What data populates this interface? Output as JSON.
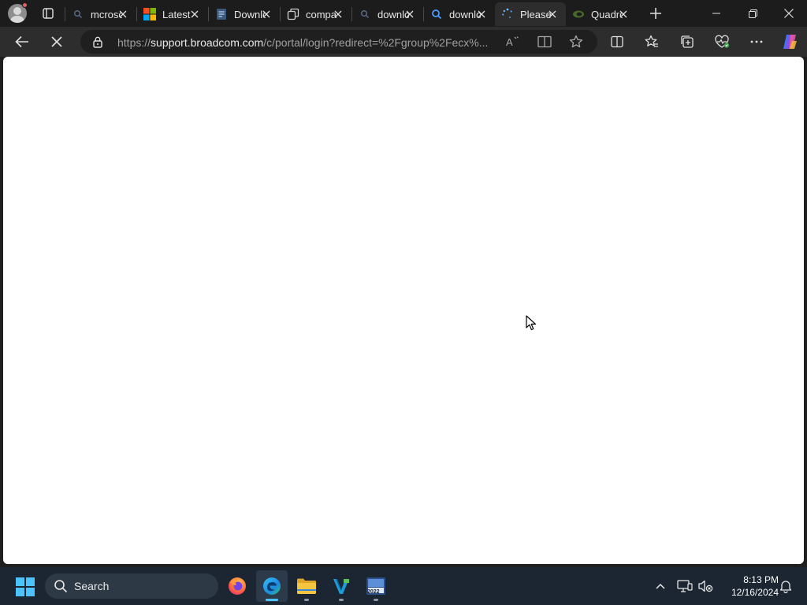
{
  "browser": {
    "tabs": [
      {
        "title": "mcrosoft",
        "favicon": "search-icon",
        "active": false
      },
      {
        "title": "Latest",
        "favicon": "microsoft-logo-icon",
        "active": false
      },
      {
        "title": "Download",
        "favicon": "document-icon",
        "active": false
      },
      {
        "title": "compare",
        "favicon": "copy-icon",
        "active": false
      },
      {
        "title": "download",
        "favicon": "search-icon",
        "active": false
      },
      {
        "title": "download",
        "favicon": "search-icon",
        "active": false
      },
      {
        "title": "Please wait",
        "favicon": "loading-spinner-icon",
        "active": true
      },
      {
        "title": "Quadro",
        "favicon": "nvidia-icon",
        "active": false
      }
    ],
    "address_bar": {
      "scheme": "https://",
      "host": "support.broadcom.com",
      "path": "/c/portal/login?redirect=%2Fgroup%2Fecx%..."
    },
    "loading": true
  },
  "taskbar": {
    "search_label": "Search",
    "apps": [
      "firefox-icon",
      "edge-icon",
      "file-explorer-icon",
      "visual-studio-icon",
      "app-2022-icon"
    ],
    "active_app": "edge-icon",
    "app_2022_label": "2022",
    "clock": {
      "time": "8:13 PM",
      "date": "12/16/2024"
    }
  },
  "colors": {
    "accent": "#4cc2ff",
    "tab_strip": "#1c1c1c",
    "toolbar": "#2d2d2d",
    "taskbar": "#1c2633",
    "page": "#ffffff"
  }
}
